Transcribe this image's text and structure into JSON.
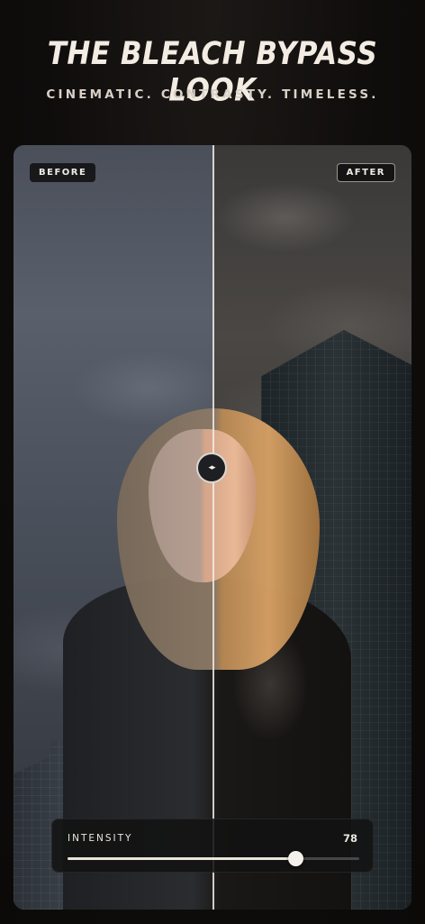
{
  "header": {
    "title": "THE BLEACH BYPASS LOOK",
    "subtitle": "CINEMATIC. CONTRASTY. TIMELESS."
  },
  "comparison": {
    "before_label": "BEFORE",
    "after_label": "AFTER",
    "handle_glyph": "◂▸",
    "handle_icon": "split-handle-icon"
  },
  "intensity": {
    "label": "INTENSITY",
    "value": "78",
    "fraction": 0.78
  },
  "colors": {
    "background": "#0e0c0b",
    "text": "#f3ece3",
    "accent": "#e9e4dc"
  }
}
